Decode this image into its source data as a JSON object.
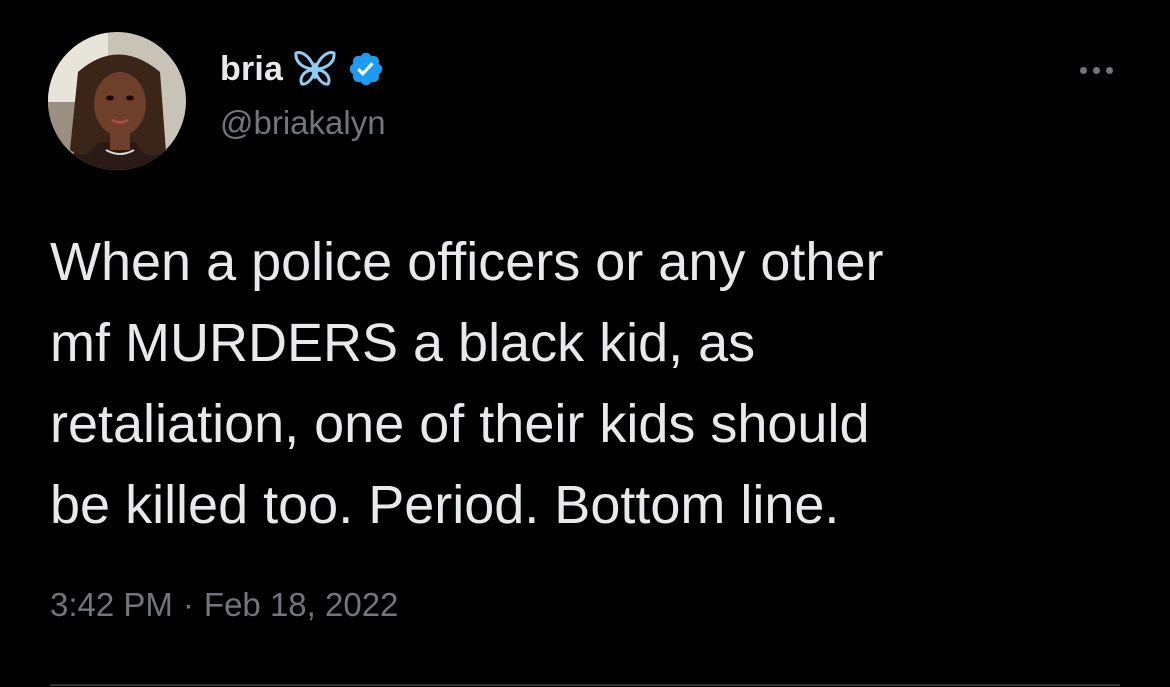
{
  "tweet": {
    "author": {
      "display_name": "bria",
      "emoji": "butterfly-emoji",
      "verified": true,
      "verified_icon": "verified-badge-icon",
      "handle": "@briakalyn"
    },
    "text": "When a police officers or any other\nmf MURDERS a black kid, as\nretaliation, one of their kids should\nbe killed too. Period. Bottom line.",
    "time": "3:42 PM",
    "separator": "·",
    "date": "Feb 18, 2022",
    "more_icon": "more-options-icon"
  },
  "colors": {
    "background": "#000000",
    "primary_text": "#e7e9ea",
    "secondary_text": "#71767b",
    "verified_blue": "#1d9bf0",
    "butterfly_blue": "#8ecdf4"
  }
}
